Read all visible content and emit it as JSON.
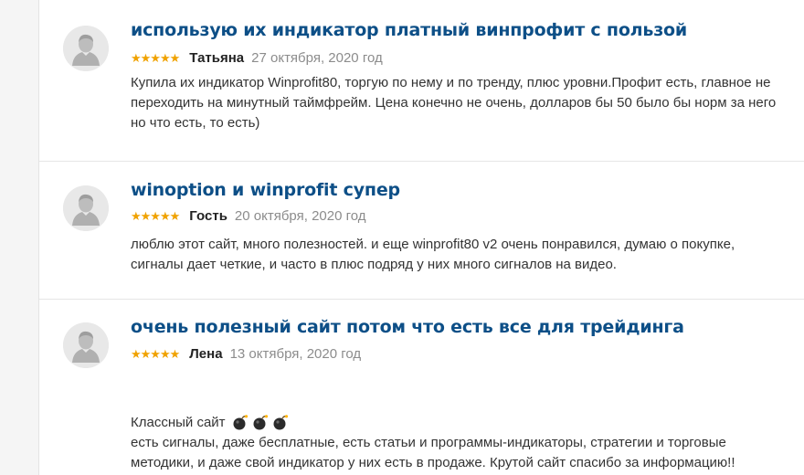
{
  "reviews": [
    {
      "title": "использую их индикатор платный винпрофит с пользой",
      "rating": 5,
      "stars": "★★★★★",
      "author": "Татьяна",
      "date": "27 октября, 2020 год",
      "lines": [
        "Купила их индикатор Winprofit80, торгую по нему и по тренду, плюс уровни.Профит есть, главное не",
        "переходить на минутный таймфрейм. Цена конечно не очень, долларов бы 50 было бы норм за него",
        "но что есть, то есть)"
      ]
    },
    {
      "title": "winoption и winprofit супер",
      "rating": 5,
      "stars": "★★★★★",
      "author": "Гость",
      "date": "20 октября, 2020 год",
      "lines": [
        "люблю этот сайт, много полезностей. и еще winprofit80 v2 очень понравился, думаю о покупке,",
        "сигналы дает четкие, и часто в плюс подряд у них много сигналов на видео."
      ]
    },
    {
      "title": "очень полезный сайт потом что есть все для трейдинга",
      "rating": 5,
      "stars": "★★★★★",
      "author": "Лена",
      "date": "13 октября, 2020 год",
      "first_line": "Классный сайт",
      "emoji": "bomb-emoji",
      "emoji_count": 3,
      "lines": [
        "есть сигналы, даже бесплатные, есть статьи и программы-индикаторы, стратегии и торговые",
        "методики, и даже свой индикатор у них есть в продаже. Крутой сайт спасибо за информацию!!"
      ]
    }
  ]
}
